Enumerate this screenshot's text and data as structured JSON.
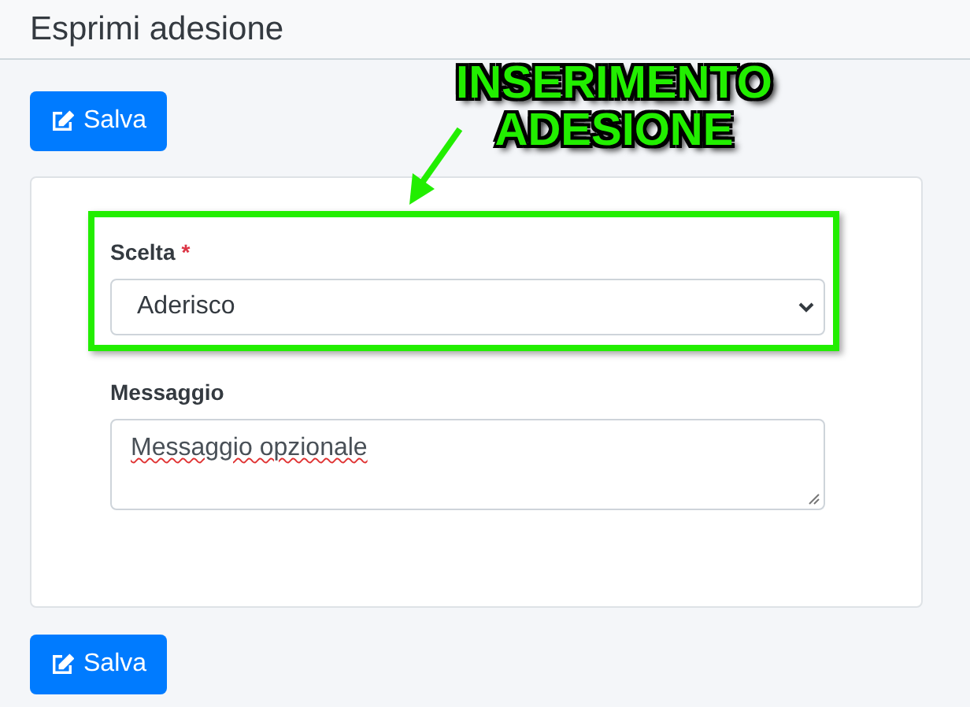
{
  "page_title": "Esprimi adesione",
  "top_button": {
    "label": "Salva"
  },
  "required_mark": "*",
  "fields": [
    {
      "kind": "select",
      "label": "Scelta",
      "required": true,
      "value": "Aderisco",
      "highlighted": true
    },
    {
      "kind": "textarea",
      "label": "Messaggio",
      "required": false,
      "value": "Messaggio opzionale",
      "highlighted": false
    }
  ],
  "bottom_button": {
    "label": "Salva"
  },
  "annotation": {
    "lines": [
      "INSERIMENTO",
      "ADESIONE"
    ]
  }
}
